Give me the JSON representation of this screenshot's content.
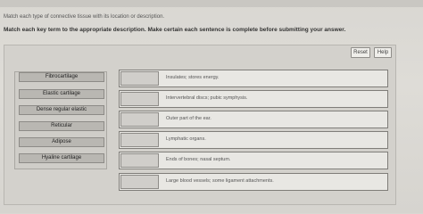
{
  "header": {
    "title_partial": ""
  },
  "instructions": {
    "line1": "Match each type of connective tissue with its location or description.",
    "line2": "Match each key term to the appropriate description. Make certain each sentence is complete before submitting your answer."
  },
  "toolbar": {
    "reset_label": "Reset",
    "help_label": "Help"
  },
  "terms": [
    {
      "label": "Fibrocartilage"
    },
    {
      "label": "Elastic cartilage"
    },
    {
      "label": "Dense regular elastic"
    },
    {
      "label": "Reticular"
    },
    {
      "label": "Adipose"
    },
    {
      "label": "Hyaline cartilage"
    }
  ],
  "descriptions": [
    {
      "text": "Insulates; stores energy."
    },
    {
      "text": "Intervertebral discs; pubic symphysis."
    },
    {
      "text": "Outer part of the ear."
    },
    {
      "text": "Lymphatic organs."
    },
    {
      "text": "Ends of bones; nasal septum."
    },
    {
      "text": "Large blood vessels; some ligament attachments."
    }
  ]
}
